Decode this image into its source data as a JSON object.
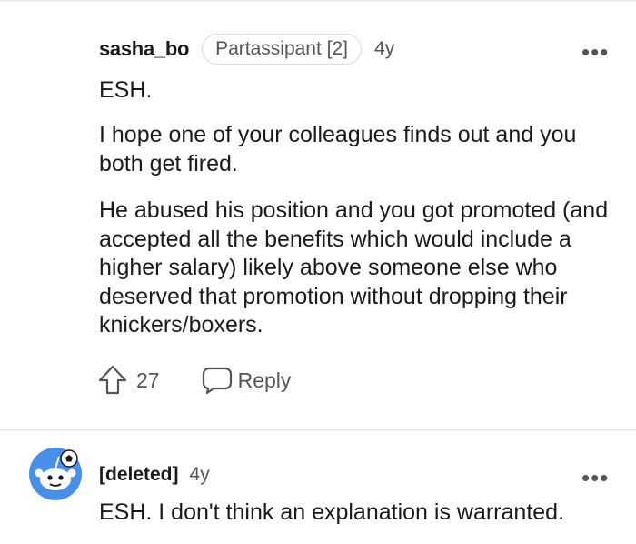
{
  "comment1": {
    "username": "sasha_bo",
    "flair": "Partassipant [2]",
    "age": "4y",
    "paragraphs": [
      "ESH.",
      "I hope one of your colleagues finds out and you both get fired.",
      "He abused his position and you got promoted (and accepted all the benefits which would include a higher salary) likely above someone else who deserved that promotion without dropping their knickers/boxers."
    ],
    "upvotes": "27",
    "reply_label": "Reply",
    "more_icon": "more-options-icon"
  },
  "comment2": {
    "username": "[deleted]",
    "age": "4y",
    "text": "ESH. I don't think an explanation is warranted.",
    "avatar_icon": "snoo-avatar-icon",
    "more_icon": "more-options-icon"
  },
  "colors": {
    "text": "#1a1a1b",
    "muted": "#555555",
    "divider": "#e9ebed",
    "avatar_bg": "#4a8fe7"
  }
}
